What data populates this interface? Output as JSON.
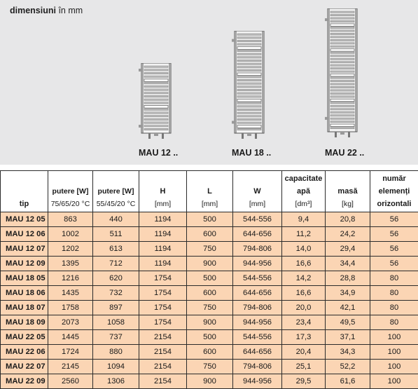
{
  "dimensions": {
    "title_bold": "dimensiuni",
    "title_rest": " în mm"
  },
  "radiators": [
    {
      "label": "MAU 12 .."
    },
    {
      "label": "MAU 18 .."
    },
    {
      "label": "MAU 22 .."
    }
  ],
  "table": {
    "headers": [
      {
        "title": "tip",
        "unit": ""
      },
      {
        "title": "putere [W]",
        "unit": "75/65/20 °C"
      },
      {
        "title": "putere [W]",
        "unit": "55/45/20 °C"
      },
      {
        "title": "H",
        "unit": "[mm]"
      },
      {
        "title": "L",
        "unit": "[mm]"
      },
      {
        "title": "W",
        "unit": "[mm]"
      },
      {
        "title": "capacitate apă",
        "unit": "[dm³]"
      },
      {
        "title": "masă",
        "unit": "[kg]"
      },
      {
        "title": "număr elemenți orizontali",
        "unit": ""
      }
    ],
    "rows": [
      [
        "MAU 12 05",
        "863",
        "440",
        "1194",
        "500",
        "544-556",
        "9,4",
        "20,8",
        "56"
      ],
      [
        "MAU 12 06",
        "1002",
        "511",
        "1194",
        "600",
        "644-656",
        "11,2",
        "24,2",
        "56"
      ],
      [
        "MAU 12 07",
        "1202",
        "613",
        "1194",
        "750",
        "794-806",
        "14,0",
        "29,4",
        "56"
      ],
      [
        "MAU 12 09",
        "1395",
        "712",
        "1194",
        "900",
        "944-956",
        "16,6",
        "34,4",
        "56"
      ],
      [
        "MAU 18 05",
        "1216",
        "620",
        "1754",
        "500",
        "544-556",
        "14,2",
        "28,8",
        "80"
      ],
      [
        "MAU 18 06",
        "1435",
        "732",
        "1754",
        "600",
        "644-656",
        "16,6",
        "34,9",
        "80"
      ],
      [
        "MAU 18 07",
        "1758",
        "897",
        "1754",
        "750",
        "794-806",
        "20,0",
        "42,1",
        "80"
      ],
      [
        "MAU 18 09",
        "2073",
        "1058",
        "1754",
        "900",
        "944-956",
        "23,4",
        "49,5",
        "80"
      ],
      [
        "MAU 22 05",
        "1445",
        "737",
        "2154",
        "500",
        "544-556",
        "17,3",
        "37,1",
        "100"
      ],
      [
        "MAU 22 06",
        "1724",
        "880",
        "2154",
        "600",
        "644-656",
        "20,4",
        "34,3",
        "100"
      ],
      [
        "MAU 22 07",
        "2145",
        "1094",
        "2154",
        "750",
        "794-806",
        "25,1",
        "52,2",
        "100"
      ],
      [
        "MAU 22 09",
        "2560",
        "1306",
        "2154",
        "900",
        "944-956",
        "29,5",
        "61,6",
        "100"
      ]
    ]
  }
}
